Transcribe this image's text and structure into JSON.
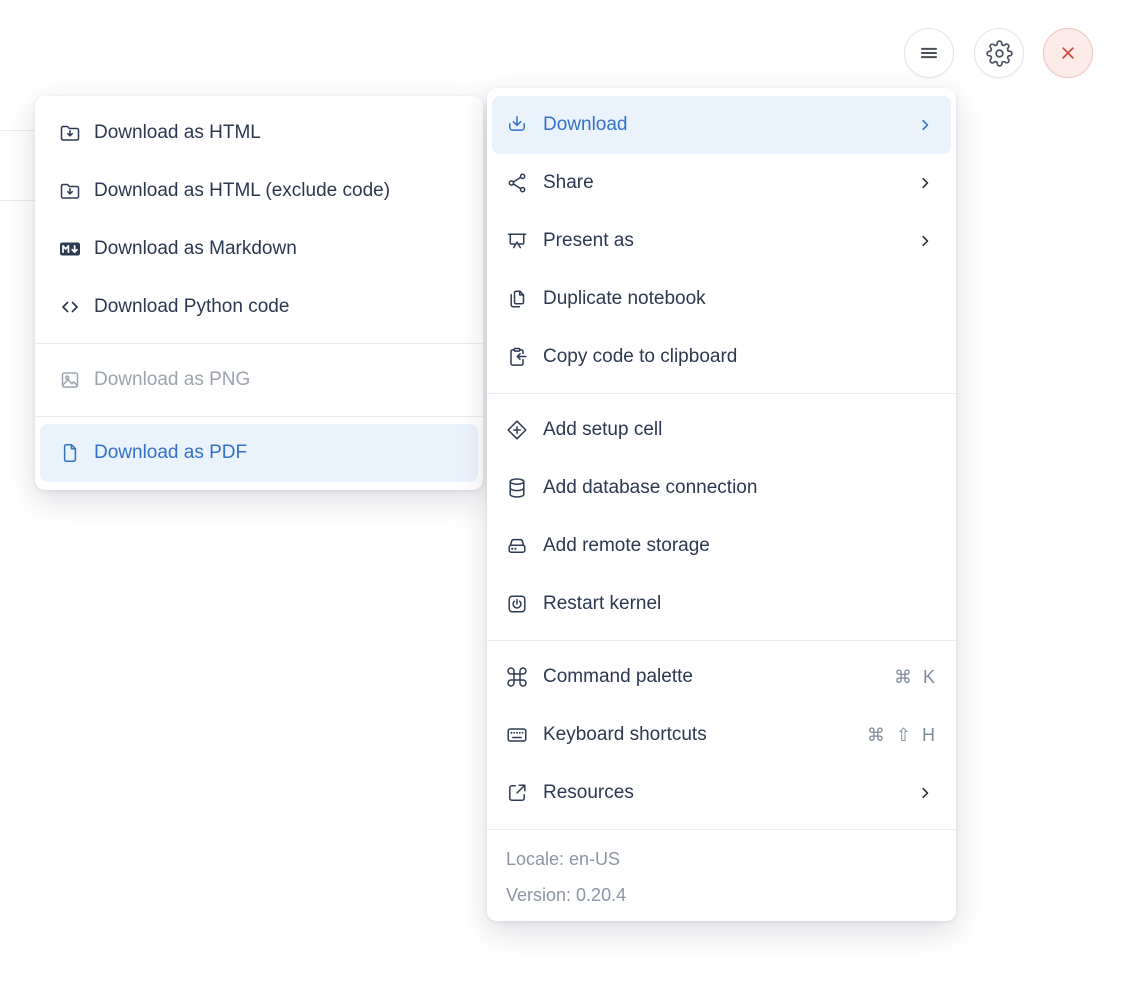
{
  "colors": {
    "accent_blue": "#3371c7",
    "highlight_bg": "#eaf2fc",
    "text_dark": "#2b3850",
    "text_disabled": "#9ba3ae",
    "text_muted": "#8b95a4",
    "danger_red": "#cb4437",
    "close_btn_bg": "#fcebe8"
  },
  "topbar": {
    "menu_button": {
      "icon": "hamburger-icon"
    },
    "settings_button": {
      "icon": "gear-icon"
    },
    "close_button": {
      "icon": "close-icon"
    }
  },
  "download_submenu": {
    "items": [
      {
        "label": "Download as HTML",
        "icon": "folder-download-icon",
        "state": "normal"
      },
      {
        "label": "Download as HTML (exclude code)",
        "icon": "folder-download-icon",
        "state": "normal"
      },
      {
        "label": "Download as Markdown",
        "icon": "markdown-icon",
        "state": "normal"
      },
      {
        "label": "Download Python code",
        "icon": "code-icon",
        "state": "normal"
      },
      {
        "label": "Download as PNG",
        "icon": "image-icon",
        "state": "disabled"
      },
      {
        "label": "Download as PDF",
        "icon": "file-icon",
        "state": "highlighted"
      }
    ]
  },
  "main_menu": {
    "items": [
      {
        "label": "Download",
        "icon": "download-icon",
        "state": "highlighted",
        "has_submenu": true
      },
      {
        "label": "Share",
        "icon": "share-icon",
        "has_submenu": true
      },
      {
        "label": "Present as",
        "icon": "presentation-icon",
        "has_submenu": true
      },
      {
        "label": "Duplicate notebook",
        "icon": "duplicate-icon"
      },
      {
        "label": "Copy code to clipboard",
        "icon": "clipboard-import-icon"
      },
      {
        "label": "Add setup cell",
        "icon": "diamond-plus-icon"
      },
      {
        "label": "Add database connection",
        "icon": "database-icon"
      },
      {
        "label": "Add remote storage",
        "icon": "remote-storage-icon"
      },
      {
        "label": "Restart kernel",
        "icon": "restart-kernel-icon"
      },
      {
        "label": "Command palette",
        "icon": "command-icon",
        "shortcut": "⌘ K"
      },
      {
        "label": "Keyboard shortcuts",
        "icon": "keyboard-icon",
        "shortcut": "⌘ ⇧ H"
      },
      {
        "label": "Resources",
        "icon": "external-link-icon",
        "has_submenu": true
      }
    ],
    "footer": {
      "locale": "Locale: en-US",
      "version": "Version: 0.20.4"
    }
  }
}
